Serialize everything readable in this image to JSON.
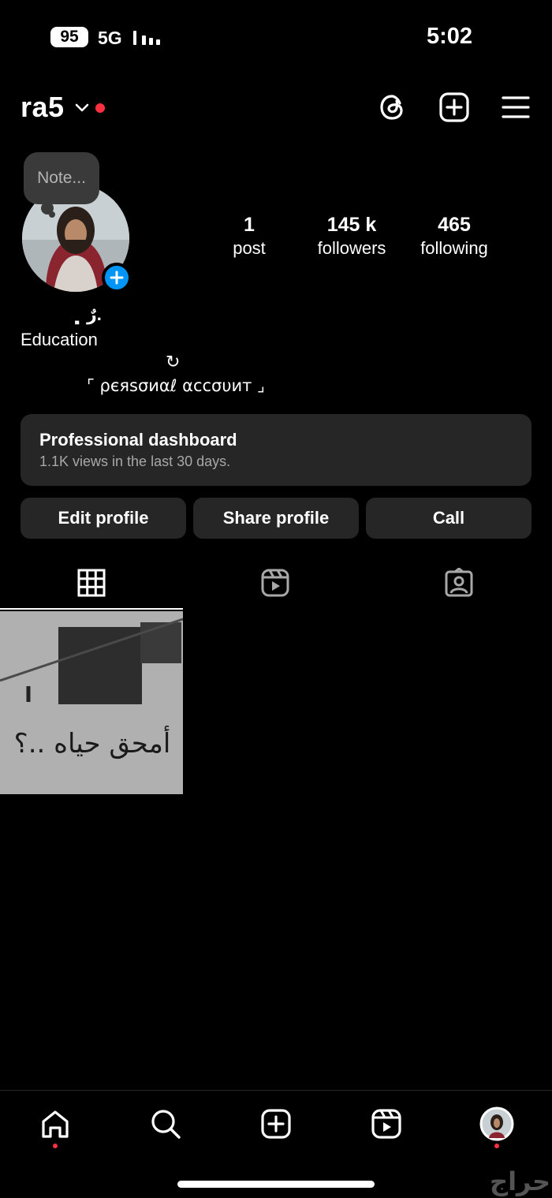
{
  "status_bar": {
    "battery": "95",
    "network": "5G",
    "time": "5:02"
  },
  "header": {
    "username": "ra5",
    "icons": [
      "threads-icon",
      "create-plus-icon",
      "menu-icon"
    ]
  },
  "profile": {
    "note_placeholder": "Note...",
    "stats": [
      {
        "value": "1",
        "label": "post"
      },
      {
        "value": "145 k",
        "label": "followers"
      },
      {
        "value": "465",
        "label": "following"
      }
    ],
    "display_name": "رٌ ﮼.",
    "category": "Education",
    "refresh_glyph": "↻",
    "bio": "⌜ ρєяѕσиαℓ αccσυит ⌟"
  },
  "dashboard": {
    "title": "Professional dashboard",
    "subtitle": "1.1K views in the last 30 days."
  },
  "buttons": {
    "edit": "Edit profile",
    "share": "Share profile",
    "call": "Call"
  },
  "tabs": [
    "grid-icon",
    "reels-icon",
    "tagged-icon"
  ],
  "post": {
    "caption_art": "أمحق حياه ..؟"
  },
  "bottom_nav": [
    "home-icon",
    "search-icon",
    "create-icon",
    "reels-icon",
    "profile-avatar"
  ],
  "watermark": "حراج",
  "colors": {
    "accent_blue": "#0095f6",
    "notification_red": "#ff3040",
    "card_bg": "#262626"
  }
}
